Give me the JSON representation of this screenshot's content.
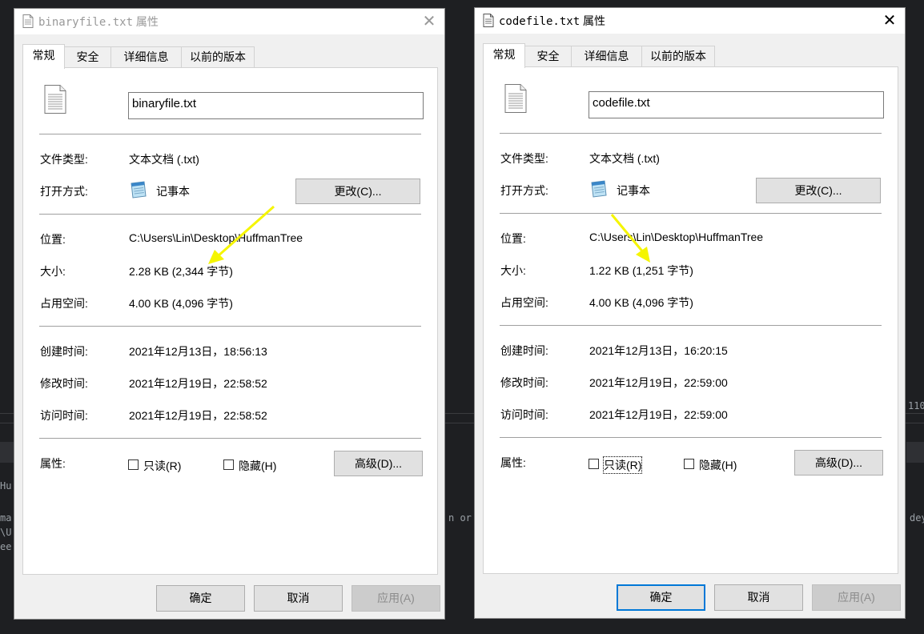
{
  "background": {
    "lines": [
      "Hu",
      "ma",
      "\\U",
      "ee",
      "n or",
      "dey",
      "110"
    ]
  },
  "dialogs": [
    {
      "title_file": "binaryfile.txt",
      "title_suffix": "属性",
      "close_glyph": "✕",
      "tabs": [
        "常规",
        "安全",
        "详细信息",
        "以前的版本"
      ],
      "filename": "binaryfile.txt",
      "labels": {
        "type": "文件类型:",
        "opens_with": "打开方式:",
        "location": "位置:",
        "size": "大小:",
        "size_on_disk": "占用空间:",
        "created": "创建时间:",
        "modified": "修改时间:",
        "accessed": "访问时间:",
        "attributes": "属性:"
      },
      "values": {
        "type": "文本文档 (.txt)",
        "opens_with": "记事本",
        "location": "C:\\Users\\Lin\\Desktop\\HuffmanTree",
        "size": "2.28 KB (2,344 字节)",
        "size_on_disk": "4.00 KB (4,096 字节)",
        "created": "2021年12月13日，18:56:13",
        "modified": "2021年12月19日，22:58:52",
        "accessed": "2021年12月19日，22:58:52"
      },
      "change_button": "更改(C)...",
      "readonly_label": "只读(R)",
      "hidden_label": "隐藏(H)",
      "advanced_button": "高级(D)...",
      "ok": "确定",
      "cancel": "取消",
      "apply": "应用(A)"
    },
    {
      "title_file": "codefile.txt",
      "title_suffix": "属性",
      "close_glyph": "✕",
      "tabs": [
        "常规",
        "安全",
        "详细信息",
        "以前的版本"
      ],
      "filename": "codefile.txt",
      "labels": {
        "type": "文件类型:",
        "opens_with": "打开方式:",
        "location": "位置:",
        "size": "大小:",
        "size_on_disk": "占用空间:",
        "created": "创建时间:",
        "modified": "修改时间:",
        "accessed": "访问时间:",
        "attributes": "属性:"
      },
      "values": {
        "type": "文本文档 (.txt)",
        "opens_with": "记事本",
        "location": "C:\\Users\\Lin\\Desktop\\HuffmanTree",
        "size": "1.22 KB (1,251 字节)",
        "size_on_disk": "4.00 KB (4,096 字节)",
        "created": "2021年12月13日，16:20:15",
        "modified": "2021年12月19日，22:59:00",
        "accessed": "2021年12月19日，22:59:00"
      },
      "change_button": "更改(C)...",
      "readonly_label": "只读(R)",
      "hidden_label": "隐藏(H)",
      "advanced_button": "高级(D)...",
      "ok": "确定",
      "cancel": "取消",
      "apply": "应用(A)"
    }
  ],
  "annotation_color": "#f5f500"
}
